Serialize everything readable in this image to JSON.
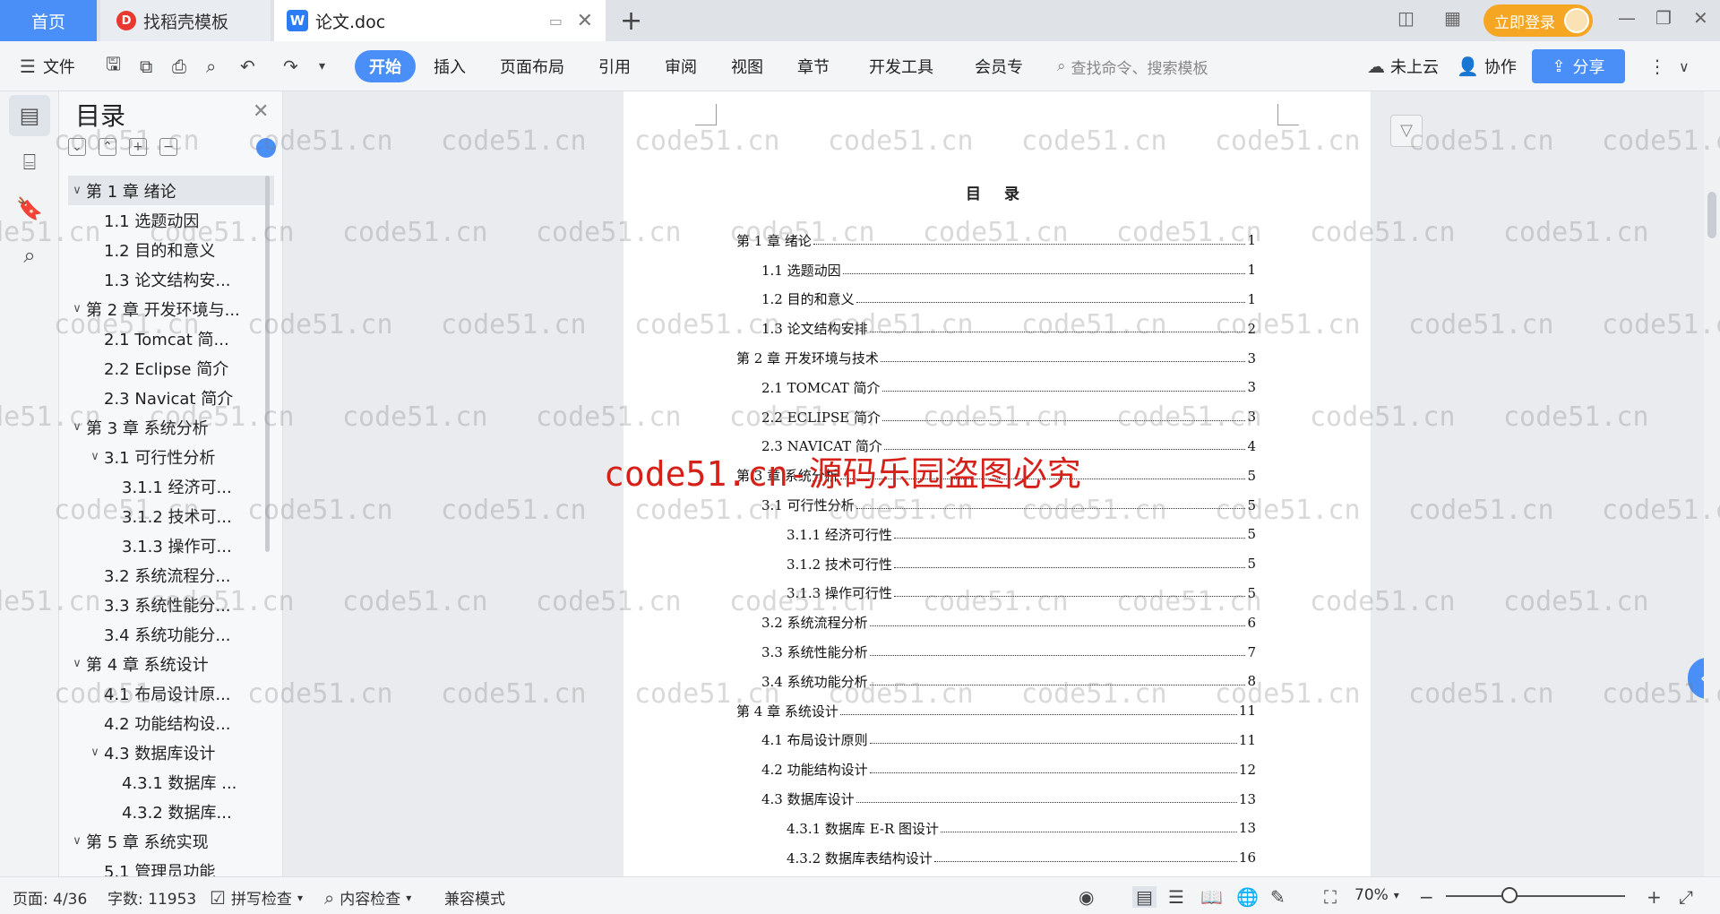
{
  "tabs": {
    "home": "首页",
    "template": "找稻壳模板",
    "doc": "论文.doc",
    "add": "+"
  },
  "account": {
    "login": "立即登录"
  },
  "ribbon": {
    "file": "文件",
    "tabs": [
      "开始",
      "插入",
      "页面布局",
      "引用",
      "审阅",
      "视图",
      "章节",
      "开发工具",
      "会员专"
    ],
    "search_placeholder": "查找命令、搜索模板",
    "cloud": "未上云",
    "collab": "协作",
    "share": "分享"
  },
  "sidebar": {
    "title": "目录",
    "items": [
      {
        "label": "第 1 章 绪论",
        "level": 0,
        "expanded": true
      },
      {
        "label": "1.1 选题动因",
        "level": 1
      },
      {
        "label": "1.2 目的和意义",
        "level": 1
      },
      {
        "label": "1.3 论文结构安...",
        "level": 1
      },
      {
        "label": "第 2 章 开发环境与...",
        "level": 0,
        "expanded": true
      },
      {
        "label": "2.1 Tomcat 简...",
        "level": 1
      },
      {
        "label": "2.2 Eclipse 简介",
        "level": 1
      },
      {
        "label": "2.3 Navicat 简介",
        "level": 1
      },
      {
        "label": "第 3 章 系统分析",
        "level": 0,
        "expanded": true
      },
      {
        "label": "3.1 可行性分析",
        "level": 1,
        "expanded": true
      },
      {
        "label": "3.1.1 经济可...",
        "level": 2
      },
      {
        "label": "3.1.2 技术可...",
        "level": 2
      },
      {
        "label": "3.1.3 操作可...",
        "level": 2
      },
      {
        "label": "3.2 系统流程分...",
        "level": 1
      },
      {
        "label": "3.3 系统性能分...",
        "level": 1
      },
      {
        "label": "3.4 系统功能分...",
        "level": 1
      },
      {
        "label": "第 4 章 系统设计",
        "level": 0,
        "expanded": true
      },
      {
        "label": "4.1 布局设计原...",
        "level": 1
      },
      {
        "label": "4.2 功能结构设...",
        "level": 1
      },
      {
        "label": "4.3 数据库设计",
        "level": 1,
        "expanded": true
      },
      {
        "label": "4.3.1 数据库 ...",
        "level": 2
      },
      {
        "label": "4.3.2 数据库...",
        "level": 2
      },
      {
        "label": "第 5 章 系统实现",
        "level": 0,
        "expanded": true
      },
      {
        "label": "5.1 管理员功能",
        "level": 1
      }
    ]
  },
  "document": {
    "title": "目 录",
    "toc": [
      {
        "text": "第 1 章  绪论",
        "page": "1",
        "indent": 0
      },
      {
        "text": "1.1 选题动因",
        "page": "1",
        "indent": 1
      },
      {
        "text": "1.2 目的和意义",
        "page": "1",
        "indent": 1
      },
      {
        "text": "1.3 论文结构安排",
        "page": "2",
        "indent": 1
      },
      {
        "text": "第 2 章  开发环境与技术",
        "page": "3",
        "indent": 0
      },
      {
        "text": "2.1 TOMCAT 简介",
        "page": "3",
        "indent": 1
      },
      {
        "text": "2.2 ECLIPSE 简介",
        "page": "3",
        "indent": 1
      },
      {
        "text": "2.3 NAVICAT 简介",
        "page": "4",
        "indent": 1
      },
      {
        "text": "第 3 章  系统分析",
        "page": "5",
        "indent": 0
      },
      {
        "text": "3.1 可行性分析",
        "page": "5",
        "indent": 1
      },
      {
        "text": "3.1.1  经济可行性",
        "page": "5",
        "indent": 2
      },
      {
        "text": "3.1.2  技术可行性",
        "page": "5",
        "indent": 2
      },
      {
        "text": "3.1.3  操作可行性",
        "page": "5",
        "indent": 2
      },
      {
        "text": "3.2 系统流程分析",
        "page": "6",
        "indent": 1
      },
      {
        "text": "3.3 系统性能分析",
        "page": "7",
        "indent": 1
      },
      {
        "text": "3.4 系统功能分析",
        "page": "8",
        "indent": 1
      },
      {
        "text": "第 4 章  系统设计",
        "page": "11",
        "indent": 0
      },
      {
        "text": "4.1 布局设计原则",
        "page": "11",
        "indent": 1
      },
      {
        "text": "4.2 功能结构设计",
        "page": "12",
        "indent": 1
      },
      {
        "text": "4.3 数据库设计",
        "page": "13",
        "indent": 1
      },
      {
        "text": "4.3.1  数据库 E-R 图设计",
        "page": "13",
        "indent": 2
      },
      {
        "text": "4.3.2  数据库表结构设计",
        "page": "16",
        "indent": 2
      }
    ]
  },
  "watermark": {
    "text": "code51.cn",
    "banner": "code51.cn-源码乐园盗图必究"
  },
  "status": {
    "page": "页面: 4/36",
    "words": "字数: 11953",
    "spell": "拼写检查",
    "content": "内容检查",
    "compat": "兼容模式",
    "zoom": "70%"
  }
}
